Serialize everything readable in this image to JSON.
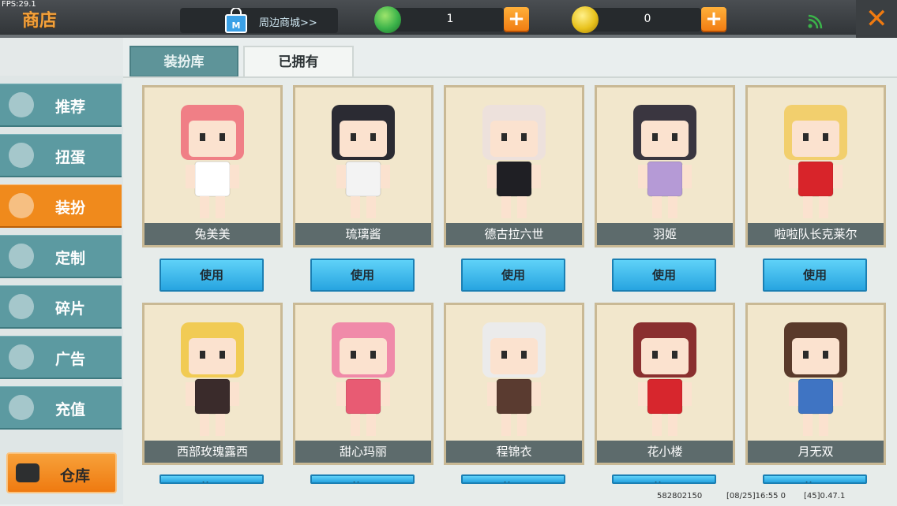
{
  "fps": "FPS:29.1",
  "title": "商店",
  "mall_link": "周边商城>>",
  "currency": [
    {
      "icon": "green-gem-icon",
      "value": "1",
      "color": "#3bb34a"
    },
    {
      "icon": "gold-coin-icon",
      "value": "0",
      "color": "#e8c21c"
    }
  ],
  "plus_label": "+",
  "close_label": "✕",
  "nav": [
    {
      "label": "推荐",
      "icon": "thumbs-up-icon",
      "active": false
    },
    {
      "label": "扭蛋",
      "icon": "capsule-icon",
      "active": false
    },
    {
      "label": "装扮",
      "icon": "shirt-icon",
      "active": true
    },
    {
      "label": "定制",
      "icon": "pencil-icon",
      "active": false
    },
    {
      "label": "碎片",
      "icon": "puzzle-icon",
      "active": false
    },
    {
      "label": "广告",
      "icon": "play-icon",
      "active": false
    },
    {
      "label": "充值",
      "icon": "coins-icon",
      "active": false
    }
  ],
  "warehouse_label": "仓库",
  "tabs": [
    {
      "label": "装扮库",
      "selected": false
    },
    {
      "label": "已拥有",
      "selected": true
    }
  ],
  "use_label": "使用",
  "skins": [
    {
      "name": "兔美美",
      "hair": "#f07f86",
      "outfit": "#ffffff"
    },
    {
      "name": "琉璃酱",
      "hair": "#2b2b33",
      "outfit": "#f3f3f3"
    },
    {
      "name": "德古拉六世",
      "hair": "#ede1dc",
      "outfit": "#1f1f24"
    },
    {
      "name": "羽姬",
      "hair": "#3a3640",
      "outfit": "#b59ad6"
    },
    {
      "name": "啦啦队长克莱尔",
      "hair": "#f2cf6d",
      "outfit": "#d8242a"
    },
    {
      "name": "西部玫瑰露西",
      "hair": "#f1cb54",
      "outfit": "#3a2b2b"
    },
    {
      "name": "甜心玛丽",
      "hair": "#f08aa9",
      "outfit": "#e85b73"
    },
    {
      "name": "程锦衣",
      "hair": "#ebebeb",
      "outfit": "#5a3b30"
    },
    {
      "name": "花小楼",
      "hair": "#8a2f2f",
      "outfit": "#d7262d"
    },
    {
      "name": "月无双",
      "hair": "#5a3a2a",
      "outfit": "#3f74c3"
    }
  ],
  "footer": {
    "uid": "582802150",
    "time": "[08/25]16:55 0",
    "version": "[45]0.47.1"
  }
}
